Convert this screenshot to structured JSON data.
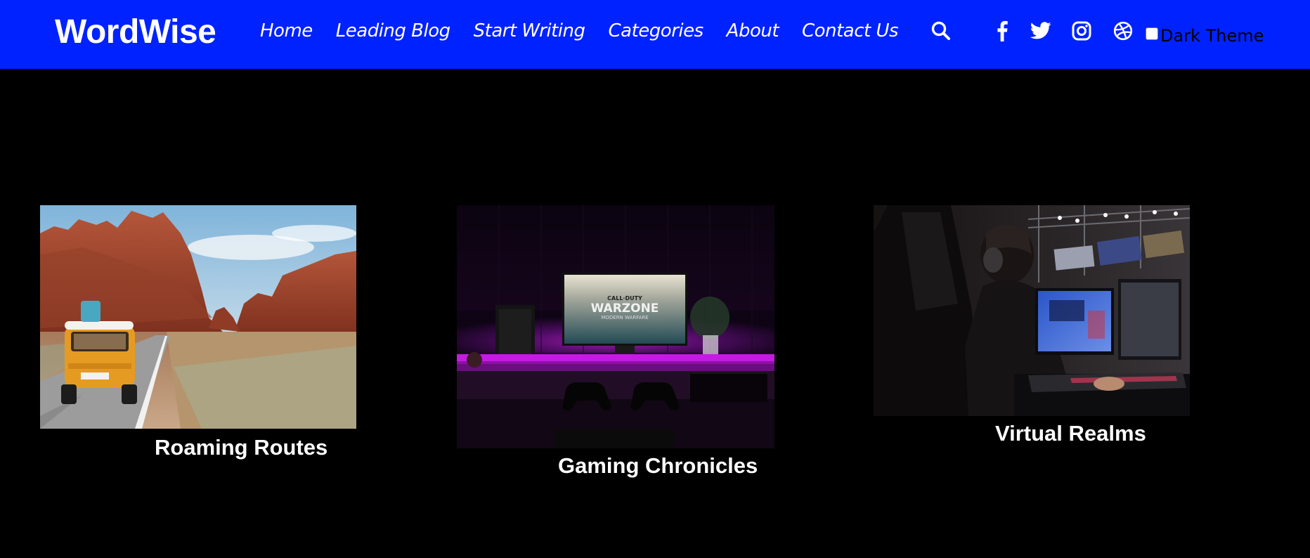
{
  "header": {
    "logo": "WordWise",
    "nav": [
      {
        "label": "Home"
      },
      {
        "label": "Leading Blog"
      },
      {
        "label": "Start Writing"
      },
      {
        "label": "Categories"
      },
      {
        "label": "About"
      },
      {
        "label": "Contact Us"
      }
    ],
    "icons": [
      "search-icon",
      "facebook-icon",
      "twitter-icon",
      "instagram-icon",
      "dribbble-icon"
    ],
    "theme_toggle": {
      "label": "Dark Theme",
      "checked": false
    }
  },
  "cards": [
    {
      "title": "Roaming Routes",
      "image": "orange van on desert road with red rock cliffs"
    },
    {
      "title": "Gaming Chronicles",
      "image": "gaming desk with monitor showing Call of Duty Warzone and purple lighting"
    },
    {
      "title": "Virtual Realms",
      "image": "gamer with headset at esports arena"
    }
  ],
  "monitor_text": {
    "line1": "CALL·DUTY",
    "line2": "WARZONE",
    "line3": "MODERN WARFARE"
  },
  "colors": {
    "navbar_bg": "#0022ff",
    "page_bg": "#000000",
    "text": "#ffffff"
  }
}
